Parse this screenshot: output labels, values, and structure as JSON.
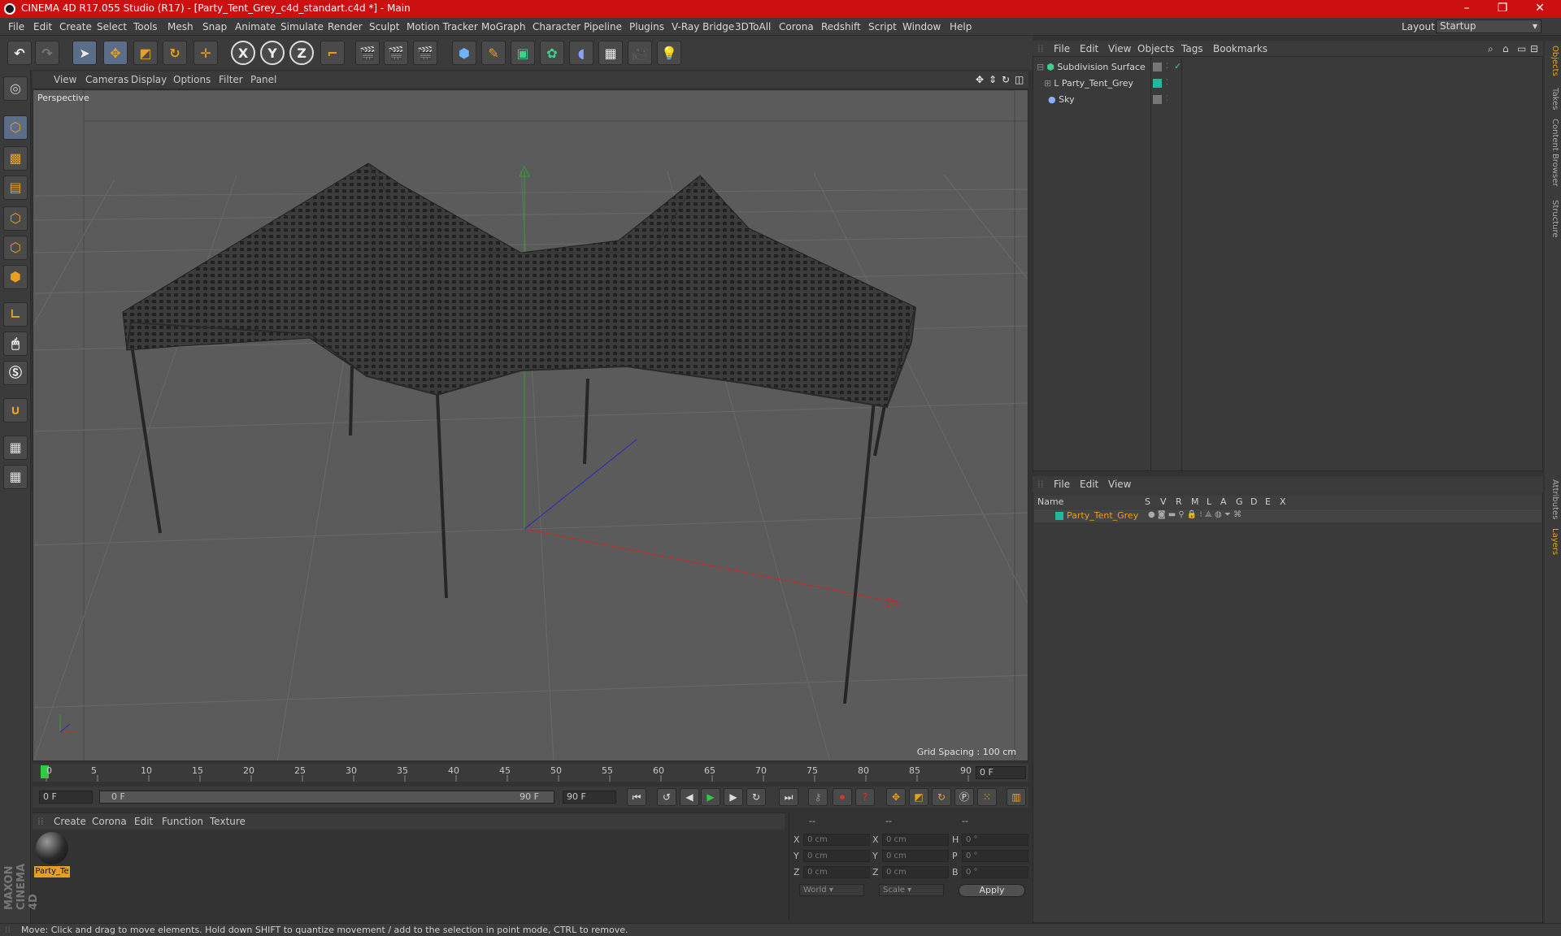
{
  "window": {
    "title": "CINEMA 4D R17.055 Studio (R17) - [Party_Tent_Grey_c4d_standart.c4d *] - Main",
    "controls": [
      "–",
      "❐",
      "✕"
    ]
  },
  "menubar": {
    "items": [
      "File",
      "Edit",
      "Create",
      "Select",
      "Tools",
      "Mesh",
      "Snap",
      "Animate",
      "Simulate",
      "Render",
      "Sculpt",
      "Motion Tracker",
      "MoGraph",
      "Character",
      "Pipeline",
      "Plugins",
      "V-Ray Bridge",
      "3DToAll",
      "Corona",
      "Redshift",
      "Script",
      "Window",
      "Help"
    ],
    "layout_label": "Layout:",
    "layout_value": "Startup"
  },
  "toolbar": {
    "axis_x": "X",
    "axis_y": "Y",
    "axis_z": "Z"
  },
  "viewport": {
    "menu": [
      "View",
      "Cameras",
      "Display",
      "Options",
      "Filter",
      "Panel"
    ],
    "label": "Perspective",
    "grid_spacing": "Grid Spacing : 100 cm"
  },
  "timeline": {
    "ticks": [
      "0",
      "5",
      "10",
      "15",
      "20",
      "25",
      "30",
      "35",
      "40",
      "45",
      "50",
      "55",
      "60",
      "65",
      "70",
      "75",
      "80",
      "85",
      "90"
    ],
    "current_frame": "0 F"
  },
  "transport": {
    "start_field": "0 F",
    "range_start": "0 F",
    "range_end": "90 F",
    "end_field": "90 F"
  },
  "materials": {
    "menu": [
      "Create",
      "Corona",
      "Edit",
      "Function",
      "Texture"
    ],
    "items": [
      {
        "label": "Party_Te"
      }
    ]
  },
  "coords": {
    "headers": [
      "--",
      "--",
      "--"
    ],
    "rows": [
      {
        "a": "X",
        "av": "0 cm",
        "b": "X",
        "bv": "0 cm",
        "c": "H",
        "cv": "0 °"
      },
      {
        "a": "Y",
        "av": "0 cm",
        "b": "Y",
        "bv": "0 cm",
        "c": "P",
        "cv": "0 °"
      },
      {
        "a": "Z",
        "av": "0 cm",
        "b": "Z",
        "bv": "0 cm",
        "c": "B",
        "cv": "0 °"
      }
    ],
    "world": "World",
    "scale": "Scale",
    "apply": "Apply"
  },
  "objects": {
    "menu": [
      "File",
      "Edit",
      "View",
      "Objects",
      "Tags",
      "Bookmarks"
    ],
    "items": [
      {
        "name": "Subdivision Surface"
      },
      {
        "name": "Party_Tent_Grey"
      },
      {
        "name": "Sky"
      }
    ]
  },
  "layers": {
    "menu": [
      "File",
      "Edit",
      "View"
    ],
    "header": {
      "name": "Name",
      "flags": [
        "S",
        "V",
        "R",
        "M",
        "L",
        "A",
        "G",
        "D",
        "E",
        "X"
      ]
    },
    "items": [
      {
        "name": "Party_Tent_Grey",
        "color": "#1fb8a0"
      }
    ]
  },
  "side_tabs": [
    "Objects",
    "Takes",
    "Content Browser",
    "Structure",
    "Attributes",
    "Layers"
  ],
  "brand": "MAXON CINEMA 4D",
  "status": "Move: Click and drag to move elements. Hold down SHIFT to quantize movement / add to the selection in point mode, CTRL to remove.",
  "colors": {
    "title_bar": "#cc0f0f",
    "accent_orange": "#e8a020",
    "layer_name": "#e8a020"
  }
}
